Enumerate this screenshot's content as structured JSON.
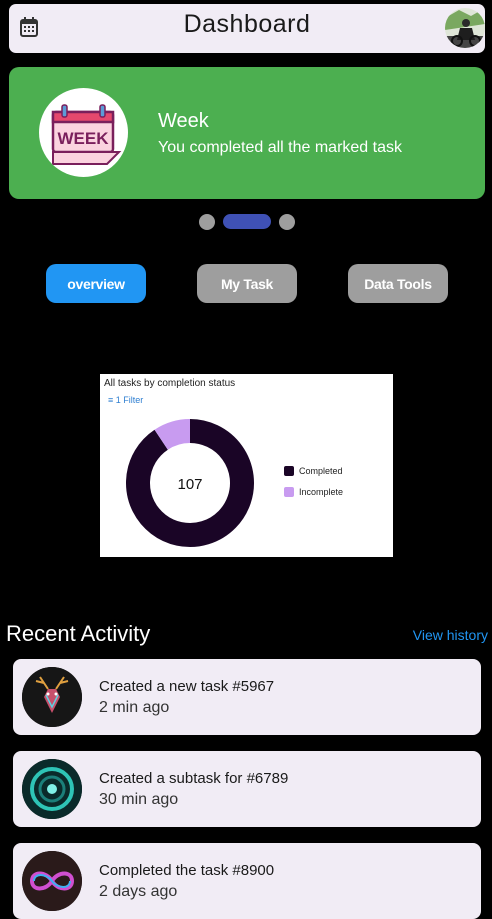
{
  "header": {
    "title": "Dashboard",
    "calendar_icon": "calendar-icon",
    "avatar": "profile-avatar"
  },
  "banner": {
    "badge_text": "WEEK",
    "title": "Week",
    "subtitle": "You completed all the marked task",
    "color": "#4caf50"
  },
  "carousel": {
    "pages": 3,
    "active_index": 1
  },
  "tabs": [
    {
      "label": "overview",
      "active": true,
      "color": "#2196f3"
    },
    {
      "label": "My Task",
      "active": false,
      "color": "#9e9e9e"
    },
    {
      "label": "Data Tools",
      "active": false,
      "color": "#9e9e9e"
    }
  ],
  "chart_card": {
    "title": "All tasks by completion status",
    "filter_label": "1 Filter",
    "filter_icon": "filter-icon"
  },
  "chart_data": {
    "type": "pie",
    "title": "All tasks by completion status",
    "center_label": "107",
    "categories": [
      "Completed",
      "Incomplete"
    ],
    "values": [
      97,
      10
    ],
    "colors": [
      "#1a0526",
      "#c89bf0"
    ],
    "legend_position": "right"
  },
  "recent": {
    "title": "Recent Activity",
    "view_history": "View history",
    "items": [
      {
        "title": "Created a new task #5967",
        "time": "2 min ago",
        "avatar": "deer-avatar"
      },
      {
        "title": "Created a subtask for #6789",
        "time": "30 min ago",
        "avatar": "neon-ring-avatar"
      },
      {
        "title": "Completed the task #8900",
        "time": "2 days ago",
        "avatar": "infinity-avatar"
      }
    ]
  }
}
